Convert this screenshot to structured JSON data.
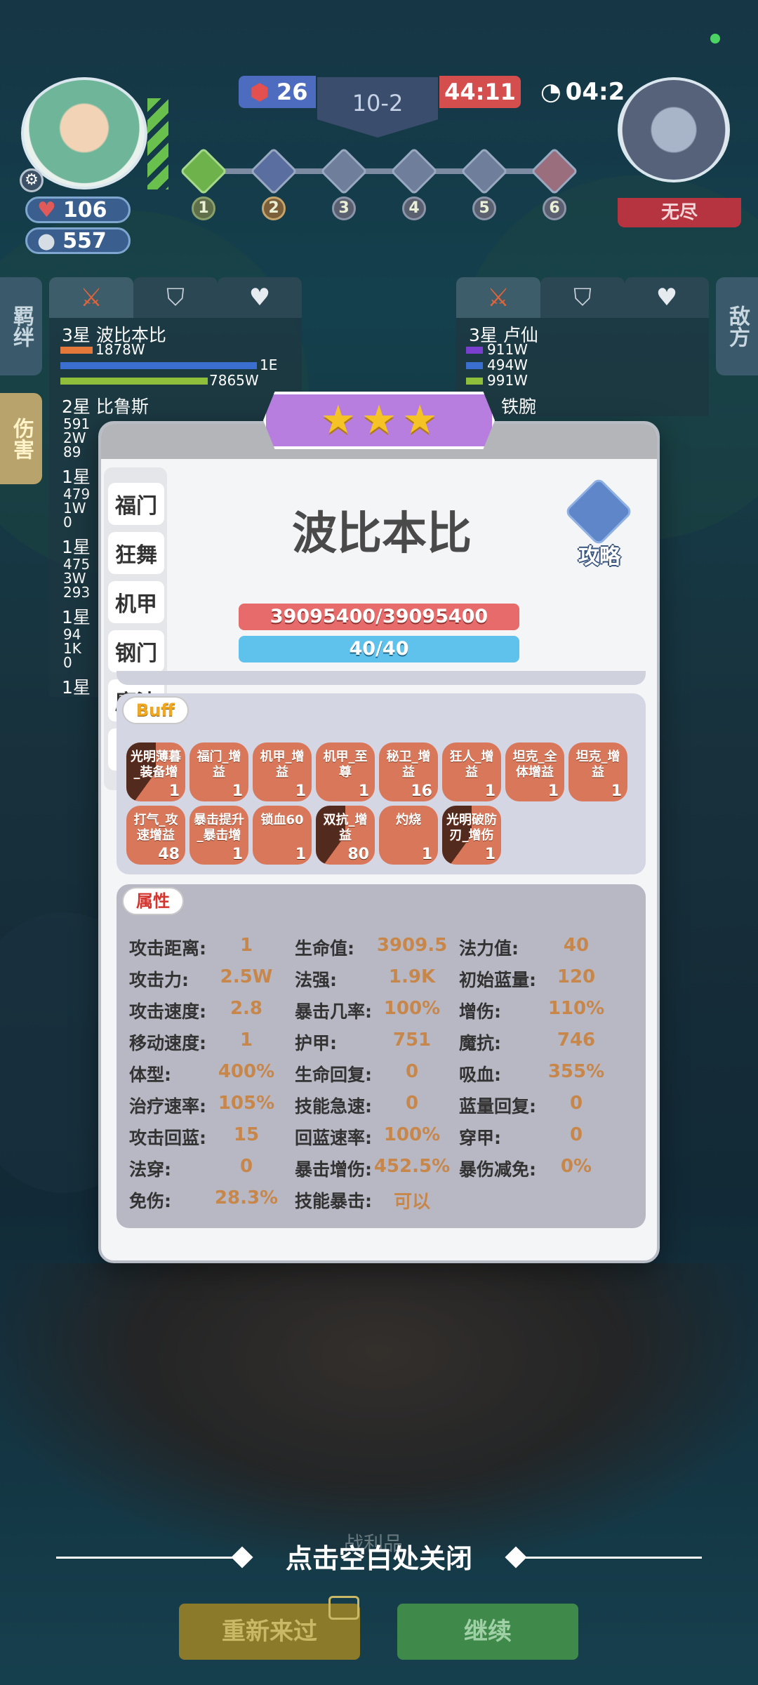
{
  "hud": {
    "player_hp": "106",
    "player_coins": "557",
    "level_badge": "26",
    "stage": "10-2",
    "timer_red": "44:11",
    "timer_clock": "04:2",
    "boss_label": "无尽",
    "route_nodes": [
      "1",
      "2",
      "3",
      "4",
      "5",
      "6"
    ]
  },
  "left_panel": {
    "side_tab_bond": "羁绊",
    "side_tab_damage": "伤害",
    "rows": [
      {
        "name": "3星 波比本比",
        "v1": "1878W",
        "v2": "1E",
        "v3": "7865W"
      },
      {
        "name": "2星 比鲁斯",
        "v1": "591",
        "v2": "2W",
        "v3": "89"
      },
      {
        "name": "1星",
        "v1": "479",
        "v2": "1W",
        "v3": "0"
      },
      {
        "name": "1星",
        "v1": "475",
        "v2": "3W",
        "v3": "293"
      },
      {
        "name": "1星",
        "v1": "94",
        "v2": "1K",
        "v3": "0"
      },
      {
        "name": "1星",
        "v1": "",
        "v2": "",
        "v3": ""
      }
    ]
  },
  "right_panel": {
    "side_tab_enemy": "敌方",
    "rows": [
      {
        "name": "3星 卢仙",
        "v1": "911W",
        "v2": "494W",
        "v3": "991W"
      },
      {
        "name": "铁腕"
      }
    ]
  },
  "dialog": {
    "hero_name": "波比本比",
    "hp": "39095400/39095400",
    "mp": "40/40",
    "guide_label": "攻略",
    "categories": [
      "福门",
      "狂舞",
      "机甲",
      "钢门",
      "魔法",
      "坦"
    ],
    "buff_title": "Buff",
    "buffs": [
      {
        "label": "光明薄暮_装备增",
        "count": "1",
        "pie": true
      },
      {
        "label": "福门_增益",
        "count": "1"
      },
      {
        "label": "机甲_增益",
        "count": "1"
      },
      {
        "label": "机甲_至尊",
        "count": "1"
      },
      {
        "label": "秘卫_增益",
        "count": "16"
      },
      {
        "label": "狂人_增益",
        "count": "1"
      },
      {
        "label": "坦克_全体增益",
        "count": "1"
      },
      {
        "label": "坦克_增益",
        "count": "1"
      },
      {
        "label": "打气_攻速增益",
        "count": "48"
      },
      {
        "label": "暴击提升_暴击增",
        "count": "1"
      },
      {
        "label": "锁血60",
        "count": "1"
      },
      {
        "label": "双抗_增益",
        "count": "80",
        "pie": true
      },
      {
        "label": "灼烧",
        "count": "1"
      },
      {
        "label": "光明破防刃_增伤",
        "count": "1",
        "pie": true
      }
    ],
    "attr_title": "属性",
    "attributes": [
      {
        "label": "攻击距离:",
        "value": "1"
      },
      {
        "label": "生命值:",
        "value": "3909.5"
      },
      {
        "label": "法力值:",
        "value": "40"
      },
      {
        "label": "攻击力:",
        "value": "2.5W"
      },
      {
        "label": "法强:",
        "value": "1.9K"
      },
      {
        "label": "初始蓝量:",
        "value": "120"
      },
      {
        "label": "攻击速度:",
        "value": "2.8"
      },
      {
        "label": "暴击几率:",
        "value": "100%"
      },
      {
        "label": "增伤:",
        "value": "110%"
      },
      {
        "label": "移动速度:",
        "value": "1"
      },
      {
        "label": "护甲:",
        "value": "751"
      },
      {
        "label": "魔抗:",
        "value": "746"
      },
      {
        "label": "体型:",
        "value": "400%"
      },
      {
        "label": "生命回复:",
        "value": "0"
      },
      {
        "label": "吸血:",
        "value": "355%"
      },
      {
        "label": "治疗速率:",
        "value": "105%"
      },
      {
        "label": "技能急速:",
        "value": "0"
      },
      {
        "label": "蓝量回复:",
        "value": "0"
      },
      {
        "label": "攻击回蓝:",
        "value": "15"
      },
      {
        "label": "回蓝速率:",
        "value": "100%"
      },
      {
        "label": "穿甲:",
        "value": "0"
      },
      {
        "label": "法穿:",
        "value": "0"
      },
      {
        "label": "暴击增伤:",
        "value": "452.5%"
      },
      {
        "label": "暴伤减免:",
        "value": "0%"
      },
      {
        "label": "免伤:",
        "value": "28.3%"
      },
      {
        "label": "技能暴击:",
        "value": "可以"
      }
    ]
  },
  "footer": {
    "close_hint": "点击空白处关闭",
    "loot_label": "战利品",
    "retry_button": "重新来过",
    "continue_button": "继续"
  },
  "colors": {
    "hp_bar": "#e86b6b",
    "mp_bar": "#5ec2ec",
    "buff_tile": "#d8775a",
    "attr_value": "#c8874a",
    "star_ribbon": "#b77ee0"
  }
}
